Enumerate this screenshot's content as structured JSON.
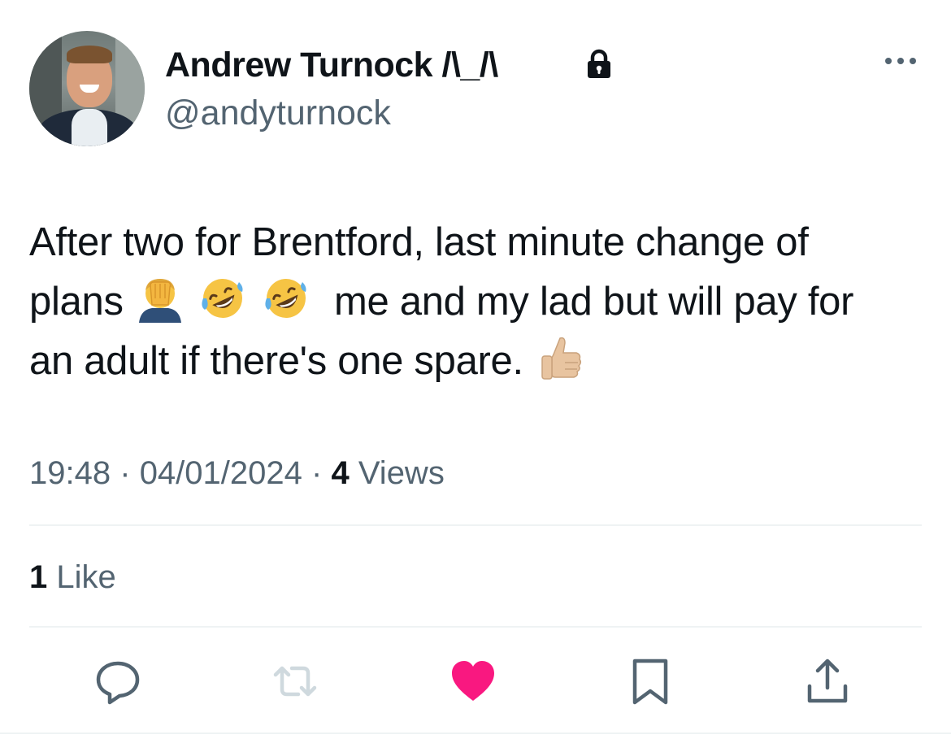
{
  "author": {
    "display_name": "Andrew Turnock /\\_/\\",
    "handle": "@andyturnock",
    "avatar_icon": "profile-photo",
    "lock_icon": "lock-icon",
    "more_icon": "more-icon"
  },
  "tweet": {
    "lines": [
      {
        "text_before": "After two for Brentford, last minute change of"
      },
      {
        "text_before": "plans",
        "emojis": [
          "face-palm",
          "rolling-on-floor-laughing",
          "rolling-on-floor-laughing"
        ],
        "text_after": "me and my lad but will pay for"
      },
      {
        "text_before": "an adult if there's one spare.",
        "emojis": [
          "thumbs-up-light-skin"
        ]
      }
    ]
  },
  "meta": {
    "time": "19:48",
    "separator": "·",
    "date": "04/01/2024",
    "views_count": "4",
    "views_label": "Views"
  },
  "engagement": {
    "likes_count": "1",
    "likes_label": "Like"
  },
  "actions": [
    {
      "name": "reply",
      "icon": "reply-icon"
    },
    {
      "name": "retweet",
      "icon": "retweet-icon"
    },
    {
      "name": "like",
      "icon": "heart-icon",
      "active": true
    },
    {
      "name": "bookmark",
      "icon": "bookmark-icon"
    },
    {
      "name": "share",
      "icon": "share-icon"
    }
  ],
  "colors": {
    "text_primary": "#0f1419",
    "text_secondary": "#536471",
    "like_active": "#f91880",
    "retweet_disabled": "#cfd9de",
    "divider": "#eff3f4"
  }
}
